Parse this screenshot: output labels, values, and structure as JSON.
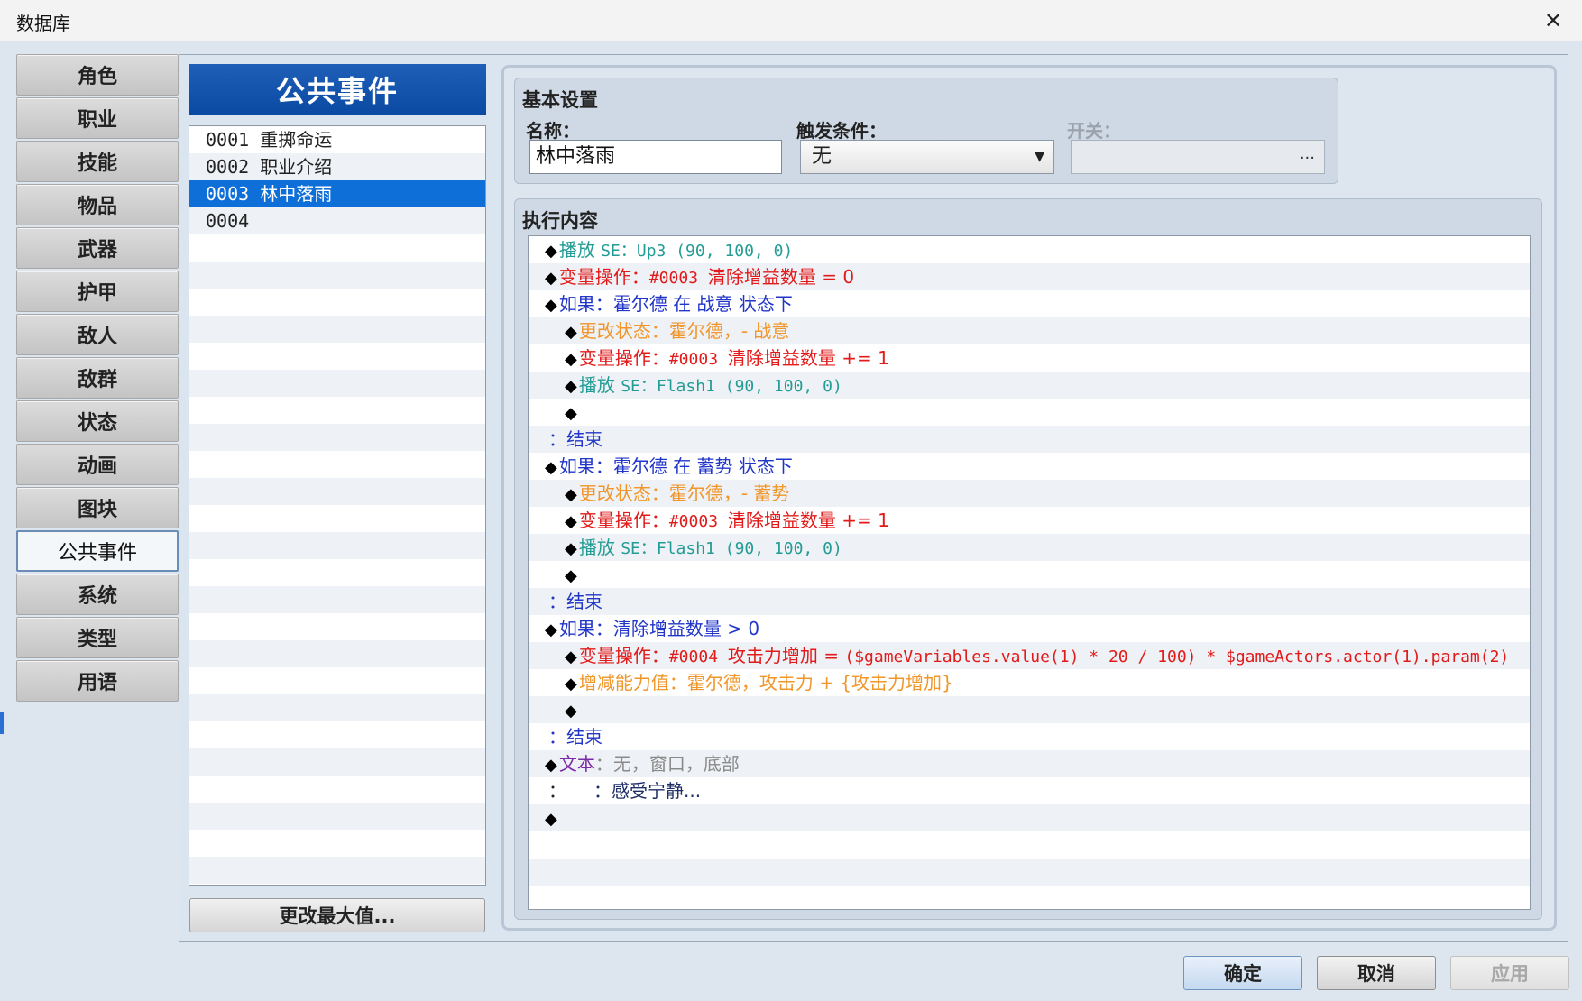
{
  "window": {
    "title": "数据库",
    "close_glyph": "✕"
  },
  "nav": {
    "items": [
      {
        "label": "角色"
      },
      {
        "label": "职业"
      },
      {
        "label": "技能"
      },
      {
        "label": "物品"
      },
      {
        "label": "武器"
      },
      {
        "label": "护甲"
      },
      {
        "label": "敌人"
      },
      {
        "label": "敌群"
      },
      {
        "label": "状态"
      },
      {
        "label": "动画"
      },
      {
        "label": "图块"
      },
      {
        "label": "公共事件"
      },
      {
        "label": "系统"
      },
      {
        "label": "类型"
      },
      {
        "label": "用语"
      }
    ],
    "selected_label": "公共事件"
  },
  "event_list": {
    "header": "公共事件",
    "rows": [
      "0001 重掷命运",
      "0002 职业介绍",
      "0003 林中落雨",
      "0004"
    ],
    "selected_row": "0003 林中落雨",
    "change_max_label": "更改最大值..."
  },
  "basic": {
    "title": "基本设置",
    "name_label": "名称：",
    "name_value": "林中落雨",
    "trigger_label": "触发条件：",
    "trigger_value": "无",
    "switch_label": "开关：",
    "switch_dots": "..."
  },
  "exec": {
    "title": "执行内容",
    "commands": [
      {
        "indent": 0,
        "parts": [
          {
            "t": "播放 ",
            "c": "teal"
          },
          {
            "t": "SE：Up3 (90, 100, 0)",
            "c": "teal",
            "mono": true
          }
        ]
      },
      {
        "indent": 0,
        "parts": [
          {
            "t": "变量操作：",
            "c": "red"
          },
          {
            "t": "#0003 ",
            "c": "red",
            "mono": true
          },
          {
            "t": "清除增益数量 = 0",
            "c": "red"
          }
        ]
      },
      {
        "indent": 0,
        "parts": [
          {
            "t": "如果：霍尔德 在 战意 状态下",
            "c": "blue"
          }
        ]
      },
      {
        "indent": 1,
        "parts": [
          {
            "t": "更改状态：霍尔德，- 战意",
            "c": "orange"
          }
        ]
      },
      {
        "indent": 1,
        "parts": [
          {
            "t": "变量操作：",
            "c": "red"
          },
          {
            "t": "#0003 ",
            "c": "red",
            "mono": true
          },
          {
            "t": "清除增益数量 += 1",
            "c": "red"
          }
        ]
      },
      {
        "indent": 1,
        "parts": [
          {
            "t": "播放 ",
            "c": "teal"
          },
          {
            "t": "SE：Flash1 (90, 100, 0)",
            "c": "teal",
            "mono": true
          }
        ]
      },
      {
        "indent": 1,
        "parts": []
      },
      {
        "indent": 0,
        "end": true,
        "parts": [
          {
            "t": "：结束",
            "c": "blue"
          }
        ]
      },
      {
        "indent": 0,
        "parts": [
          {
            "t": "如果：霍尔德 在 蓄势 状态下",
            "c": "blue"
          }
        ]
      },
      {
        "indent": 1,
        "parts": [
          {
            "t": "更改状态：霍尔德，- 蓄势",
            "c": "orange"
          }
        ]
      },
      {
        "indent": 1,
        "parts": [
          {
            "t": "变量操作：",
            "c": "red"
          },
          {
            "t": "#0003 ",
            "c": "red",
            "mono": true
          },
          {
            "t": "清除增益数量 += 1",
            "c": "red"
          }
        ]
      },
      {
        "indent": 1,
        "parts": [
          {
            "t": "播放 ",
            "c": "teal"
          },
          {
            "t": "SE：Flash1 (90, 100, 0)",
            "c": "teal",
            "mono": true
          }
        ]
      },
      {
        "indent": 1,
        "parts": []
      },
      {
        "indent": 0,
        "end": true,
        "parts": [
          {
            "t": "：结束",
            "c": "blue"
          }
        ]
      },
      {
        "indent": 0,
        "parts": [
          {
            "t": "如果：清除增益数量 > 0",
            "c": "blue"
          }
        ]
      },
      {
        "indent": 1,
        "parts": [
          {
            "t": "变量操作：",
            "c": "red"
          },
          {
            "t": "#0004 ",
            "c": "red",
            "mono": true
          },
          {
            "t": "攻击力增加 = ",
            "c": "red"
          },
          {
            "t": "($gameVariables.value(1) * 20 / 100) * $gameActors.actor(1).param(2)",
            "c": "red",
            "mono": true
          }
        ]
      },
      {
        "indent": 1,
        "parts": [
          {
            "t": "增减能力值：霍尔德，攻击力 + {攻击力增加}",
            "c": "orange"
          }
        ]
      },
      {
        "indent": 1,
        "parts": []
      },
      {
        "indent": 0,
        "end": true,
        "parts": [
          {
            "t": "：结束",
            "c": "blue"
          }
        ]
      },
      {
        "indent": 0,
        "parts": [
          {
            "t": "文本",
            "c": "purple"
          },
          {
            "t": "：无，窗口，底部",
            "c": "gray"
          }
        ]
      },
      {
        "indent": 0,
        "cont": true,
        "parts": [
          {
            "t": "：感受宁静...",
            "c": "dark"
          }
        ]
      },
      {
        "indent": 0,
        "parts": []
      }
    ]
  },
  "buttons": {
    "ok": "确定",
    "cancel": "取消",
    "apply": "应用"
  }
}
